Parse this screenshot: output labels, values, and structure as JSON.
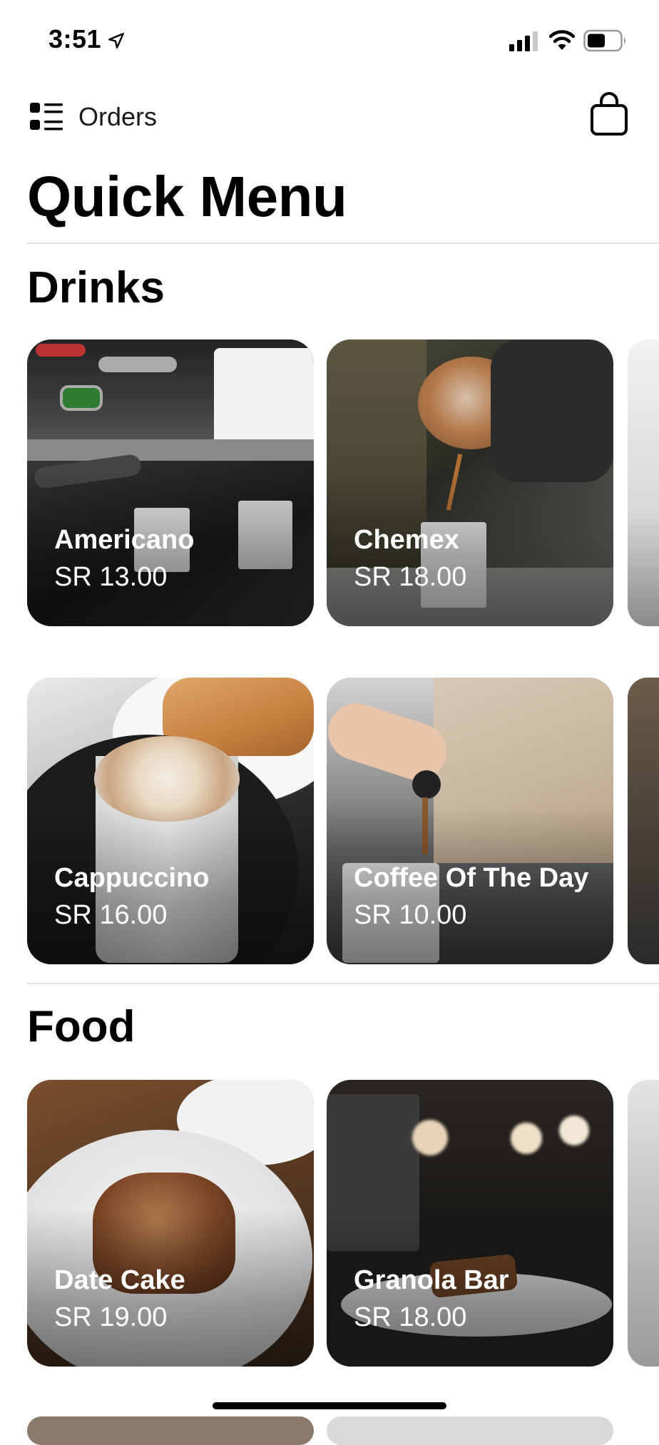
{
  "status_bar": {
    "time": "3:51"
  },
  "nav": {
    "orders_label": "Orders"
  },
  "page": {
    "title": "Quick Menu"
  },
  "sections": [
    {
      "title": "Drinks",
      "items": [
        {
          "name": "Americano",
          "price": "SR 13.00"
        },
        {
          "name": "Chemex",
          "price": "SR 18.00"
        },
        {
          "name": "Cappuccino",
          "price": "SR 16.00"
        },
        {
          "name": "Coffee Of The Day",
          "price": "SR 10.00"
        }
      ]
    },
    {
      "title": "Food",
      "items": [
        {
          "name": "Date Cake",
          "price": "SR 19.00"
        },
        {
          "name": "Granola Bar",
          "price": "SR 18.00"
        }
      ]
    }
  ],
  "icons": [
    "location-arrow-icon",
    "signal-icon",
    "wifi-icon",
    "battery-icon",
    "list-icon",
    "shopping-bag-icon"
  ],
  "colors": {
    "background": "#ffffff",
    "text": "#000000",
    "divider": "#e1e1e1",
    "card_text": "#ffffff"
  }
}
